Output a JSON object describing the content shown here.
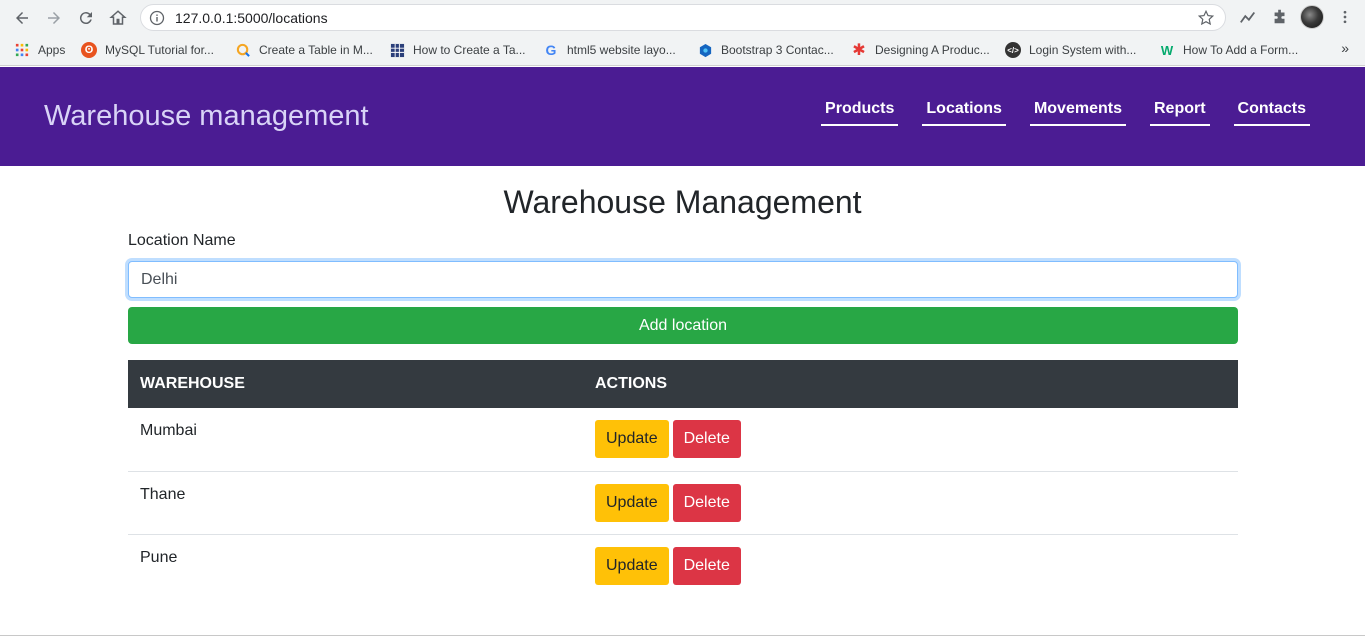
{
  "browser": {
    "url": "127.0.0.1:5000/locations",
    "bookmarks": [
      {
        "label": "Apps",
        "icon": "apps-grid-icon"
      },
      {
        "label": "MySQL Tutorial for...",
        "icon": "mysql-tutorial-favicon"
      },
      {
        "label": "Create a Table in M...",
        "icon": "create-table-favicon"
      },
      {
        "label": "How to Create a Ta...",
        "icon": "table-grid-favicon"
      },
      {
        "label": "html5 website layo...",
        "icon": "google-favicon"
      },
      {
        "label": "Bootstrap 3 Contac...",
        "icon": "bootstrap-favicon"
      },
      {
        "label": "Designing A Produc...",
        "icon": "asterisk-favicon"
      },
      {
        "label": "Login System with...",
        "icon": "code-favicon"
      },
      {
        "label": "How To Add a Form...",
        "icon": "w3-favicon"
      }
    ],
    "more_label": "»"
  },
  "navbar": {
    "brand": "Warehouse management",
    "links": [
      {
        "label": "Products"
      },
      {
        "label": "Locations"
      },
      {
        "label": "Movements"
      },
      {
        "label": "Report"
      },
      {
        "label": "Contacts"
      }
    ]
  },
  "main": {
    "title": "Warehouse Management",
    "form": {
      "label": "Location Name",
      "value": "Delhi",
      "submit_label": "Add location"
    },
    "table": {
      "headers": [
        "Warehouse",
        "Actions"
      ],
      "rows": [
        {
          "name": "Mumbai",
          "update_label": "Update",
          "delete_label": "Delete"
        },
        {
          "name": "Thane",
          "update_label": "Update",
          "delete_label": "Delete"
        },
        {
          "name": "Pune",
          "update_label": "Update",
          "delete_label": "Delete"
        }
      ]
    }
  },
  "colors": {
    "navbar_bg": "#4b1c93",
    "success": "#28a745",
    "warning": "#ffc107",
    "danger": "#dc3545",
    "table_header": "#343a40"
  }
}
